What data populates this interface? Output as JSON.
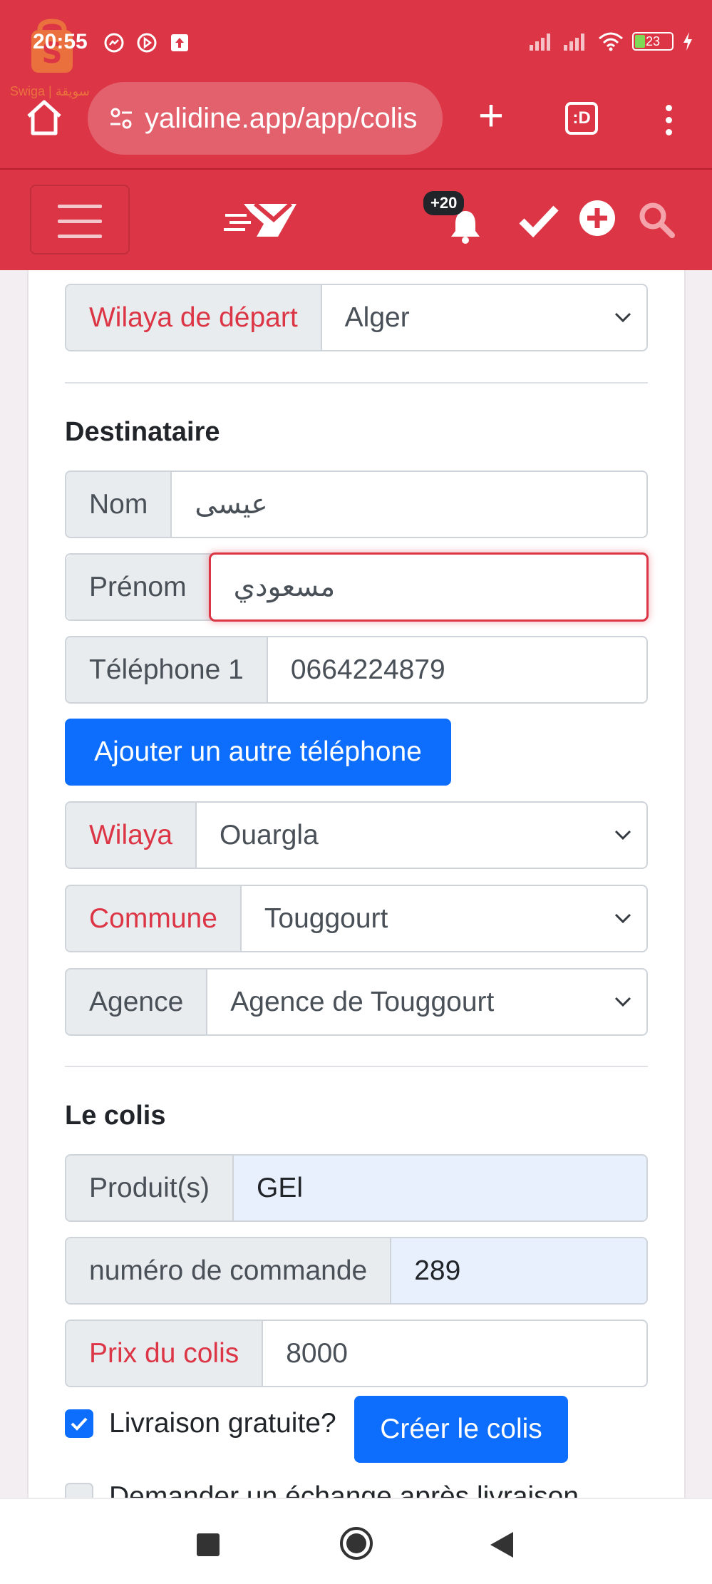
{
  "status_bar": {
    "time": "20:55",
    "battery": "23",
    "watermark": "Swiga | سويقة"
  },
  "browser": {
    "url": "yalidine.app/app/colis",
    "tabs_label": ":D"
  },
  "navbar": {
    "notif_count": "+20"
  },
  "form": {
    "depart": {
      "label": "Wilaya de départ",
      "value": "Alger"
    },
    "destinataire_title": "Destinataire",
    "nom": {
      "label": "Nom",
      "value": "عيسى"
    },
    "prenom": {
      "label": "Prénom",
      "value": "مسعودي"
    },
    "telephone": {
      "label": "Téléphone 1",
      "value": "0664224879"
    },
    "add_phone_label": "Ajouter un autre téléphone",
    "wilaya": {
      "label": "Wilaya",
      "value": "Ouargla"
    },
    "commune": {
      "label": "Commune",
      "value": "Touggourt"
    },
    "agence": {
      "label": "Agence",
      "value": "Agence de Touggourt"
    },
    "colis_title": "Le colis",
    "produits": {
      "label": "Produit(s)",
      "value": "GEl"
    },
    "commande": {
      "label": "numéro de commande",
      "value": "289"
    },
    "prix": {
      "label": "Prix du colis",
      "value": "8000"
    },
    "livraison_gratuite": {
      "label": "Livraison gratuite?",
      "checked": true
    },
    "create_label": "Créer le colis",
    "echange": {
      "label": "Demander un échange après livraison",
      "checked": false
    }
  },
  "colors": {
    "brand_red": "#dc3545",
    "primary_blue": "#0d6efd"
  }
}
